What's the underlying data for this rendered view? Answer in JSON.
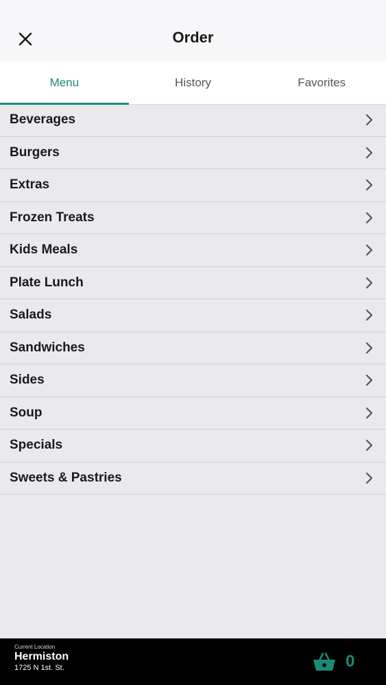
{
  "header": {
    "title": "Order",
    "close_icon": "close-icon"
  },
  "tabs": [
    {
      "label": "Menu",
      "active": true
    },
    {
      "label": "History",
      "active": false
    },
    {
      "label": "Favorites",
      "active": false
    }
  ],
  "menu": {
    "items": [
      {
        "label": "Beverages"
      },
      {
        "label": "Burgers"
      },
      {
        "label": "Extras"
      },
      {
        "label": "Frozen Treats"
      },
      {
        "label": "Kids Meals"
      },
      {
        "label": "Plate Lunch"
      },
      {
        "label": "Salads"
      },
      {
        "label": "Sandwiches"
      },
      {
        "label": "Sides"
      },
      {
        "label": "Soup"
      },
      {
        "label": "Specials"
      },
      {
        "label": "Sweets & Pastries"
      }
    ],
    "chevron_icon": "chevron-right-icon"
  },
  "footer": {
    "location_caption": "Current Location",
    "location_name": "Hermiston",
    "location_address": "1725 N 1st. St.",
    "cart_icon": "basket-icon",
    "cart_count": "0"
  },
  "colors": {
    "accent": "#1a8a78",
    "background": "#e9e9ee",
    "footer_bg": "#000000"
  }
}
